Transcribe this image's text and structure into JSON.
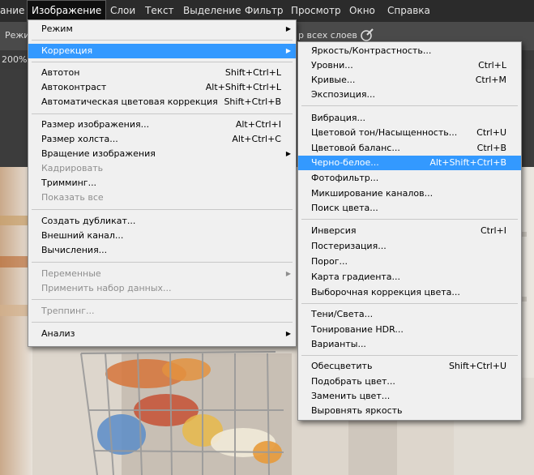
{
  "menubar": {
    "items": [
      "ание",
      "Изображение",
      "Слои",
      "Текст",
      "Выделение",
      "Фильтр",
      "Просмотр",
      "Окно",
      "Справка"
    ]
  },
  "options": {
    "mode_label": "Режим",
    "sample_all_layers": "р всех слоев"
  },
  "tab": {
    "zoom": "200%"
  },
  "image_menu": {
    "items": [
      {
        "label": "Режим",
        "shortcut": "",
        "submenu": true,
        "disabled": false
      },
      {
        "label": "Коррекция",
        "shortcut": "",
        "submenu": true,
        "disabled": false,
        "highlighted": true
      },
      {
        "label": "Автотон",
        "shortcut": "Shift+Ctrl+L",
        "disabled": false
      },
      {
        "label": "Автоконтраст",
        "shortcut": "Alt+Shift+Ctrl+L",
        "disabled": false
      },
      {
        "label": "Автоматическая цветовая коррекция",
        "shortcut": "Shift+Ctrl+B",
        "disabled": false
      },
      {
        "label": "Размер изображения...",
        "shortcut": "Alt+Ctrl+I",
        "disabled": false
      },
      {
        "label": "Размер холста...",
        "shortcut": "Alt+Ctrl+C",
        "disabled": false
      },
      {
        "label": "Вращение изображения",
        "shortcut": "",
        "submenu": true,
        "disabled": false
      },
      {
        "label": "Кадрировать",
        "shortcut": "",
        "disabled": true
      },
      {
        "label": "Тримминг...",
        "shortcut": "",
        "disabled": false
      },
      {
        "label": "Показать все",
        "shortcut": "",
        "disabled": true
      },
      {
        "label": "Создать дубликат...",
        "shortcut": "",
        "disabled": false
      },
      {
        "label": "Внешний канал...",
        "shortcut": "",
        "disabled": false
      },
      {
        "label": "Вычисления...",
        "shortcut": "",
        "disabled": false
      },
      {
        "label": "Переменные",
        "shortcut": "",
        "submenu": true,
        "disabled": true
      },
      {
        "label": "Применить набор данных...",
        "shortcut": "",
        "disabled": true
      },
      {
        "label": "Треппинг...",
        "shortcut": "",
        "disabled": true
      },
      {
        "label": "Анализ",
        "shortcut": "",
        "submenu": true,
        "disabled": false
      }
    ]
  },
  "correction_menu": {
    "items": [
      {
        "label": "Яркость/Контрастность...",
        "shortcut": ""
      },
      {
        "label": "Уровни...",
        "shortcut": "Ctrl+L"
      },
      {
        "label": "Кривые...",
        "shortcut": "Ctrl+M"
      },
      {
        "label": "Экспозиция...",
        "shortcut": ""
      },
      {
        "label": "Вибрация...",
        "shortcut": ""
      },
      {
        "label": "Цветовой тон/Насыщенность...",
        "shortcut": "Ctrl+U"
      },
      {
        "label": "Цветовой баланс...",
        "shortcut": "Ctrl+B"
      },
      {
        "label": "Черно-белое...",
        "shortcut": "Alt+Shift+Ctrl+B",
        "highlighted": true
      },
      {
        "label": "Фотофильтр...",
        "shortcut": ""
      },
      {
        "label": "Микширование каналов...",
        "shortcut": ""
      },
      {
        "label": "Поиск цвета...",
        "shortcut": ""
      },
      {
        "label": "Инверсия",
        "shortcut": "Ctrl+I"
      },
      {
        "label": "Постеризация...",
        "shortcut": ""
      },
      {
        "label": "Порог...",
        "shortcut": ""
      },
      {
        "label": "Карта градиента...",
        "shortcut": ""
      },
      {
        "label": "Выборочная коррекция цвета...",
        "shortcut": ""
      },
      {
        "label": "Тени/Света...",
        "shortcut": ""
      },
      {
        "label": "Тонирование HDR...",
        "shortcut": ""
      },
      {
        "label": "Варианты...",
        "shortcut": ""
      },
      {
        "label": "Обесцветить",
        "shortcut": "Shift+Ctrl+U"
      },
      {
        "label": "Подобрать цвет...",
        "shortcut": ""
      },
      {
        "label": "Заменить цвет...",
        "shortcut": ""
      },
      {
        "label": "Выровнять яркость",
        "shortcut": ""
      }
    ]
  },
  "colors": {
    "highlight": "#3399ff",
    "menu_bg": "#f0f0f0",
    "menubar_bg": "#2b2b2b"
  }
}
